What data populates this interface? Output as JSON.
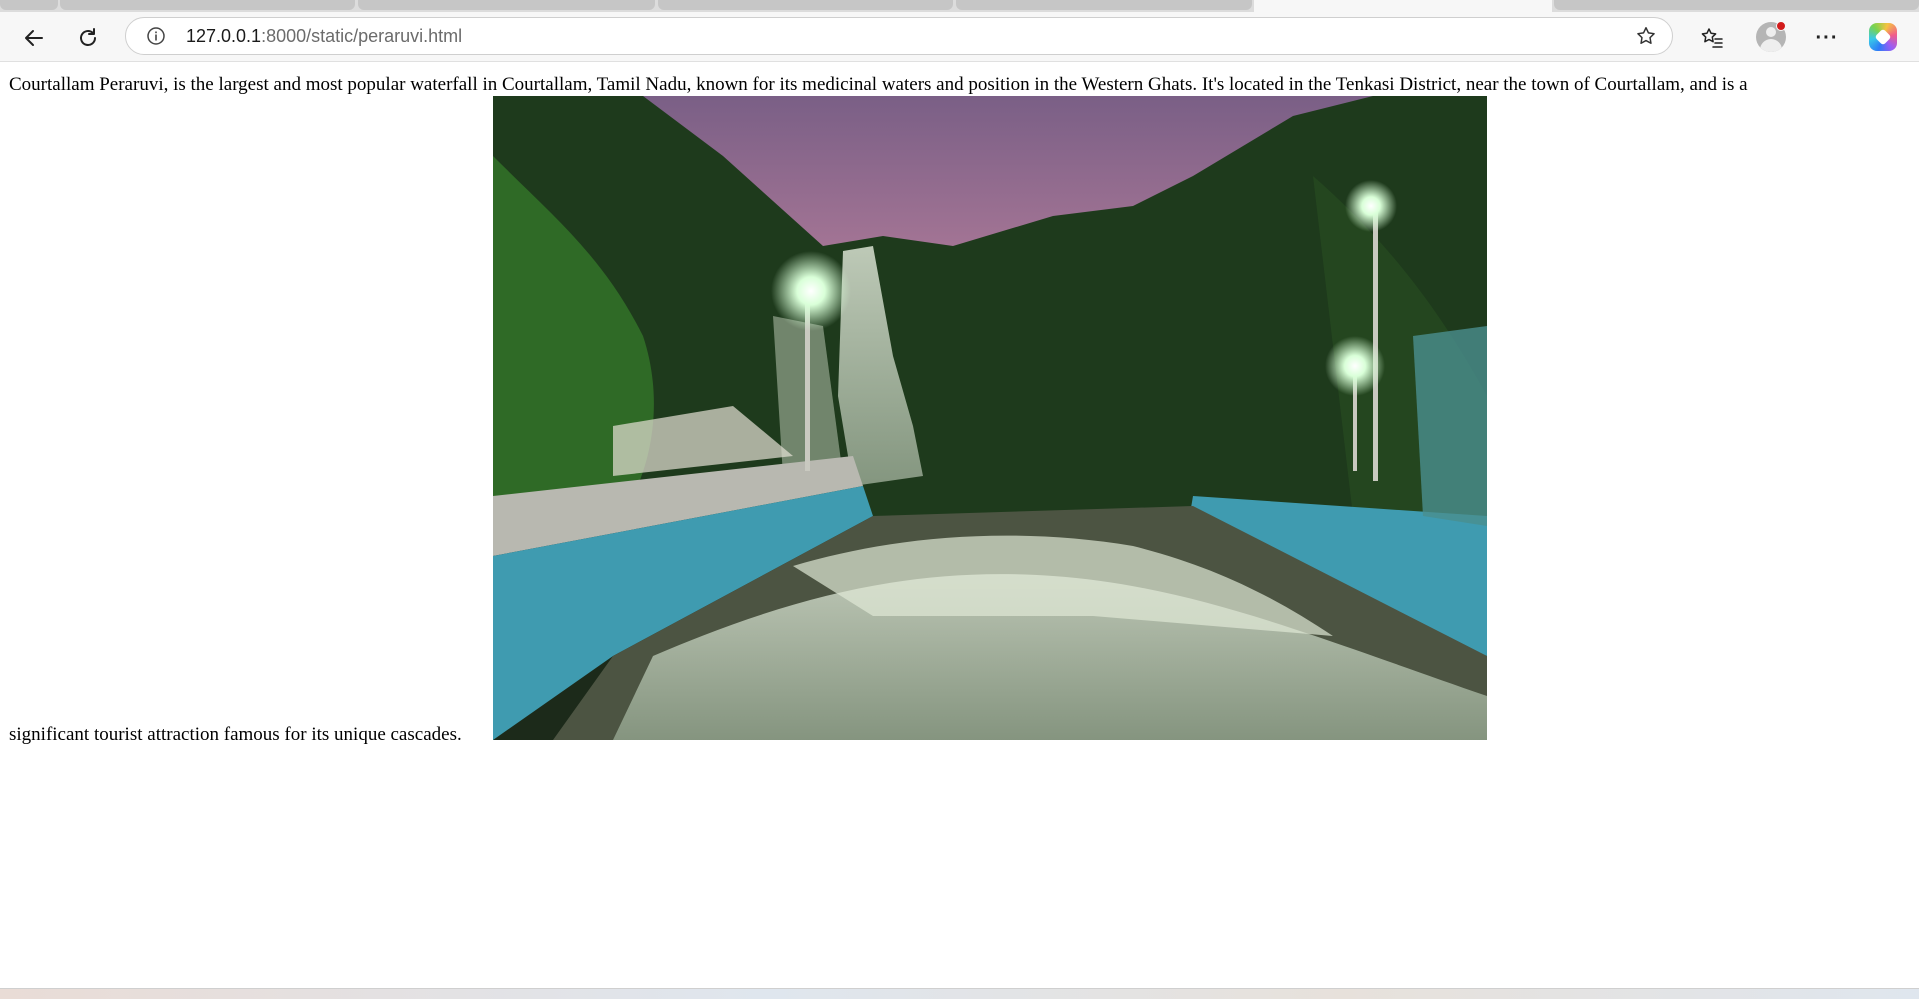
{
  "browser": {
    "url_host": "127.0.0.1",
    "url_path": ":8000/static/peraruvi.html",
    "back_icon": "back-arrow-icon",
    "reload_icon": "reload-icon",
    "info_icon": "site-info-icon",
    "star_icon": "star-icon",
    "favorites_icon": "favorites-icon",
    "menu_label": "···",
    "copilot_icon": "copilot-icon"
  },
  "page": {
    "text_line1": "Courtallam Peraruvi, is the largest and most popular waterfall in Courtallam, Tamil Nadu, known for its medicinal waters and position in the Western Ghats. It's located in the Tenkasi District, near the town of Courtallam, and is a",
    "text_line2": "significant tourist attraction famous for its unique cascades."
  },
  "colors": {
    "chrome_bg": "#f7f7f7",
    "omnibox_border": "#cfcfcf",
    "notification_dot": "#d21c1c"
  }
}
